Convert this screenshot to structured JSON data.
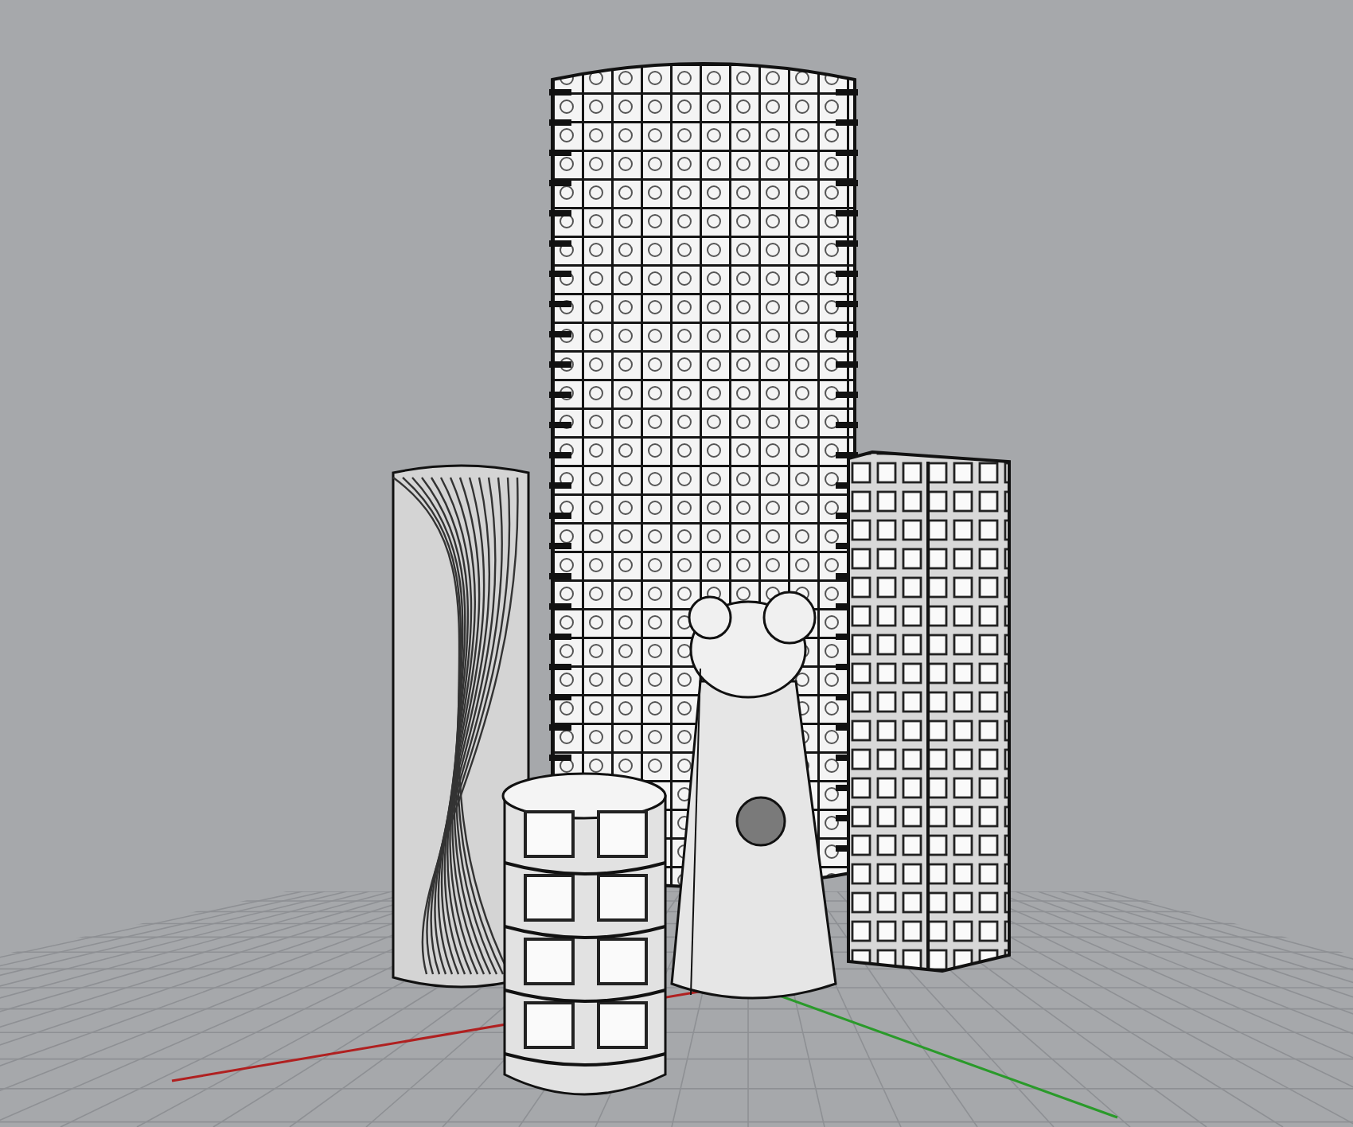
{
  "viewport": {
    "grid": true,
    "axes": true,
    "objects": [
      {
        "kind": "lattice-tower"
      },
      {
        "kind": "twisted-column"
      },
      {
        "kind": "box-tower"
      },
      {
        "kind": "cone-figure"
      },
      {
        "kind": "cage-cylinder"
      }
    ]
  }
}
